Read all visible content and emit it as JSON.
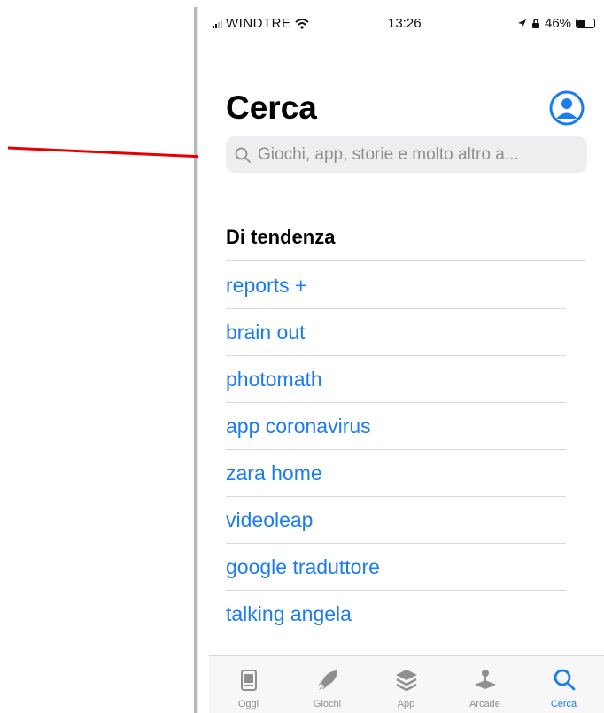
{
  "status_bar": {
    "carrier": "WINDTRE",
    "time": "13:26",
    "battery": "46%",
    "battery_level": 0.46
  },
  "header": {
    "title": "Cerca",
    "account_icon": "person-circle-icon"
  },
  "search": {
    "placeholder": "Giochi, app, storie e molto altro a..."
  },
  "trending": {
    "title": "Di tendenza",
    "items": [
      "reports +",
      "brain out",
      "photomath",
      "app coronavirus",
      "zara home",
      "videoleap",
      "google traduttore",
      "talking angela"
    ]
  },
  "tab_bar": {
    "tabs": [
      {
        "label": "Oggi",
        "icon": "today-icon"
      },
      {
        "label": "Giochi",
        "icon": "rocket-icon"
      },
      {
        "label": "App",
        "icon": "app-stack-icon"
      },
      {
        "label": "Arcade",
        "icon": "joystick-icon"
      },
      {
        "label": "Cerca",
        "icon": "search-icon"
      }
    ],
    "active": "Cerca"
  },
  "colors": {
    "accent": "#1b7cf2",
    "annotation_arrow": "#e60000",
    "search_bg": "#eeeef0",
    "secondary_text": "#8e8e93"
  }
}
